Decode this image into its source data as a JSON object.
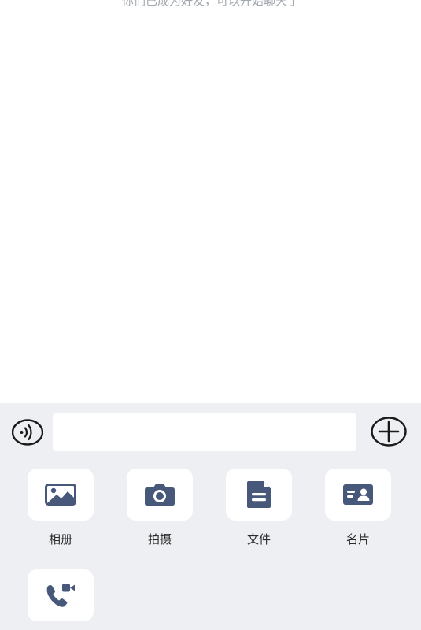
{
  "chat": {
    "system_notice": "你们已成为好友，可以开始聊天了"
  },
  "input_bar": {
    "voice_icon": "voice-wave-icon",
    "message_value": "",
    "plus_icon": "plus-circle-icon"
  },
  "tools": [
    {
      "label": "相册",
      "icon": "image-icon"
    },
    {
      "label": "拍摄",
      "icon": "camera-icon"
    },
    {
      "label": "文件",
      "icon": "file-icon"
    },
    {
      "label": "名片",
      "icon": "contact-card-icon"
    },
    {
      "label": "",
      "icon": "video-call-icon"
    }
  ],
  "colors": {
    "panel_bg": "#eeeff3",
    "icon": "#48587a",
    "notice_text": "#a3a8b0"
  }
}
